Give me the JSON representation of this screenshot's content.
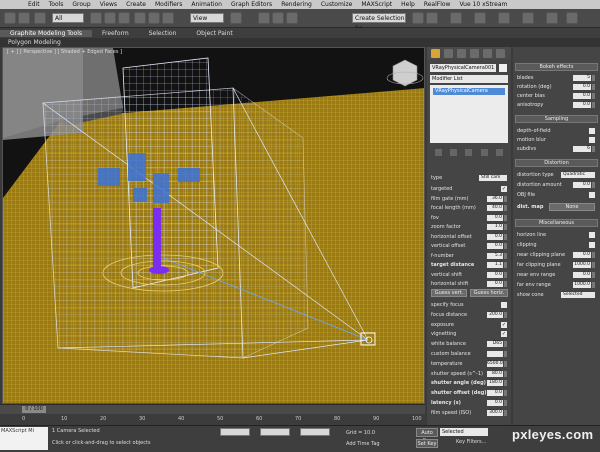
{
  "menubar": {
    "items": [
      "Edit",
      "Tools",
      "Group",
      "Views",
      "Create",
      "Modifiers",
      "Animation",
      "Graph Editors",
      "Rendering",
      "Customize",
      "MAXScript",
      "Help",
      "RealFlow",
      "Vue 10 xStream"
    ]
  },
  "toolbar": {
    "filter_value": "All",
    "view_value": "View",
    "selection_set": "Create Selection Se"
  },
  "ribbon": {
    "tabs": [
      "Graphite Modeling Tools",
      "Freeform",
      "Selection",
      "Object Paint"
    ],
    "subtitle": "Polygon Modeling"
  },
  "viewport": {
    "label": "[ + ] [ Perspective ] [ Shaded + Edged Faces ]",
    "colors": {
      "floor": "#b8961e",
      "wire": "#d8e2ff",
      "camera": "#ffffff"
    }
  },
  "modify_panel": {
    "object_name": "VRayPhysicalCamera001",
    "modifier_list": "Modifier List",
    "stack_item": "VRayPhysicalCamera",
    "type_label": "type",
    "type_value": "Still cam",
    "params": [
      {
        "label": "targeted",
        "check": "✓"
      },
      {
        "label": "film gate (mm)",
        "value": "36.0"
      },
      {
        "label": "focal length (mm)",
        "value": "40.0"
      },
      {
        "label": "fov",
        "value": "0.0"
      },
      {
        "label": "zoom factor",
        "value": "1.0"
      },
      {
        "label": "horizontal offset",
        "value": "0.0"
      },
      {
        "label": "vertical offset",
        "value": "0.0"
      },
      {
        "label": "f-number",
        "value": "5.3"
      },
      {
        "label": "target distance",
        "value": "1.1"
      },
      {
        "label": "vertical shift",
        "value": "0.0"
      },
      {
        "label": "horizontal shift",
        "value": "0.0"
      }
    ],
    "guess_vert": "Guess vert.",
    "guess_horiz": "Guess horiz.",
    "params2": [
      {
        "label": "specify focus",
        "check": ""
      },
      {
        "label": "focus distance",
        "value": "200.0"
      },
      {
        "label": "exposure",
        "check": "✓"
      },
      {
        "label": "vignetting",
        "check": "✓"
      },
      {
        "label": "white balance",
        "value": "D65"
      },
      {
        "label": "custom balance",
        "value": ""
      },
      {
        "label": "temperature",
        "value": "6500.0"
      },
      {
        "label": "shutter speed (s^-1)",
        "value": "80.0"
      },
      {
        "label": "shutter angle (deg)",
        "value": "180.0"
      },
      {
        "label": "shutter offset (deg)",
        "value": "0.0"
      },
      {
        "label": "latency (s)",
        "value": "0.0"
      },
      {
        "label": "film speed (ISO)",
        "value": "300.0"
      }
    ]
  },
  "right_panel": {
    "bokeh_title": "Bokeh effects",
    "bokeh": [
      {
        "label": "blades",
        "value": "5"
      },
      {
        "label": "rotation (deg)",
        "value": "0.0"
      },
      {
        "label": "center bias",
        "value": "0.0"
      },
      {
        "label": "anisotropy",
        "value": "0.0"
      }
    ],
    "sampling_title": "Sampling",
    "sampling": [
      {
        "label": "depth-of-field"
      },
      {
        "label": "motion blur"
      },
      {
        "label": "subdivs",
        "value": "6"
      }
    ],
    "distortion_title": "Distortion",
    "distortion_type_label": "distortion type",
    "distortion_type": "Quadratic",
    "distortion": [
      {
        "label": "distortion amount",
        "value": "0.0"
      },
      {
        "label": "OBJ file"
      }
    ],
    "dist_map_label": "dist. map",
    "dist_map_value": "None",
    "misc_title": "Miscellaneous",
    "misc": [
      {
        "label": "horizon line"
      },
      {
        "label": "clipping"
      },
      {
        "label": "near clipping plane",
        "value": "0.0"
      },
      {
        "label": "far clipping plane",
        "value": "1000.0"
      },
      {
        "label": "near env range",
        "value": "0.0"
      },
      {
        "label": "far env range",
        "value": "1000.0"
      }
    ],
    "show_cone_label": "show cone",
    "show_cone_value": "Selected"
  },
  "timeline": {
    "frame": "0 / 100",
    "ticks": [
      "0",
      "10",
      "20",
      "30",
      "40",
      "50",
      "60",
      "70",
      "80",
      "90",
      "100"
    ]
  },
  "status": {
    "maxscript": "MAXScript Mi",
    "line1": "1 Camera Selected",
    "line2": "Click or click-and-drag to select objects",
    "grid": "Grid = 10.0",
    "add_time_tag": "Add Time Tag",
    "auto_key": "Auto Key",
    "set_key": "Set Key",
    "selected": "Selected",
    "key_filters": "Key Filters..."
  },
  "watermark": "pxleyes.com"
}
